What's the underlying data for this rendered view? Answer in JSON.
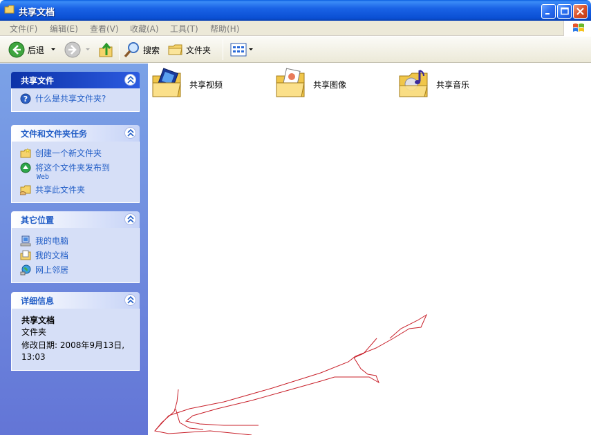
{
  "window": {
    "title": "共享文档"
  },
  "menu": [
    "文件(F)",
    "编辑(E)",
    "查看(V)",
    "收藏(A)",
    "工具(T)",
    "帮助(H)"
  ],
  "toolbar": {
    "back": "后退",
    "search": "搜索",
    "folders": "文件夹"
  },
  "panels": {
    "shared": {
      "title": "共享文件",
      "items": [
        "什么是共享文件夹?"
      ]
    },
    "tasks": {
      "title": "文件和文件夹任务",
      "items": [
        "创建一个新文件夹",
        "将这个文件夹发布到",
        "共享此文件夹"
      ],
      "publish_sub": "Web"
    },
    "places": {
      "title": "其它位置",
      "items": [
        "我的电脑",
        "我的文档",
        "网上邻居"
      ]
    },
    "details": {
      "title": "详细信息",
      "name": "共享文档",
      "type": "文件夹",
      "modified": "修改日期: 2008年9月13日,",
      "time": "13:03"
    }
  },
  "folders": [
    "共享视频",
    "共享图像",
    "共享音乐"
  ],
  "colors": {
    "titlebar": "#0a4fd3",
    "task_link": "#215dc6",
    "pane": "#6f8ee0",
    "sketch": "#c8202a"
  }
}
